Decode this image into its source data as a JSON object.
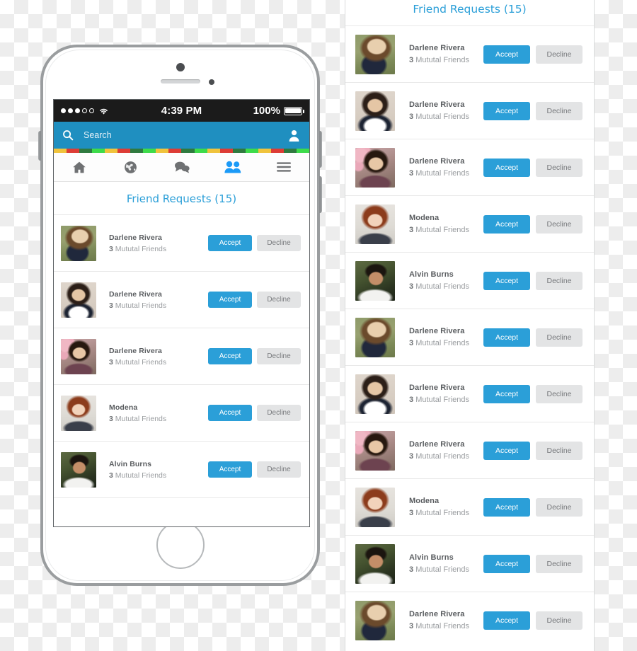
{
  "status_bar": {
    "signal_dots_filled": 3,
    "signal_dots_total": 5,
    "wifi_icon": "wifi-icon",
    "time": "4:39 PM",
    "battery_percent": "100%"
  },
  "search": {
    "icon": "search-icon",
    "placeholder": "Search",
    "profile_icon": "profile-avatar-icon"
  },
  "stripe_colors": [
    "#f0c33c",
    "#dd3c35",
    "#2f7a3f",
    "#3ddb4a"
  ],
  "tabs": [
    {
      "name": "home",
      "icon": "home-icon",
      "active": false
    },
    {
      "name": "globe",
      "icon": "globe-icon",
      "active": false
    },
    {
      "name": "messages",
      "icon": "chat-bubbles-icon",
      "active": false
    },
    {
      "name": "friends",
      "icon": "friends-icon",
      "active": true
    },
    {
      "name": "menu",
      "icon": "hamburger-menu-icon",
      "active": false
    }
  ],
  "theme": {
    "accent_blue": "#2b9fd8",
    "searchbar_blue": "#1f8fc0",
    "decline_gray": "#e3e4e5",
    "title_blue": "#2b9fd8",
    "phone_frame_gray": "#9a9d9f"
  },
  "phone_screen": {
    "title": "Friend Requests (15)",
    "buttons": {
      "accept": "Accept",
      "decline": "Decline"
    },
    "requests": [
      {
        "name": "Darlene Rivera",
        "mutual_count": "3",
        "mutual_label": "Mututal Friends",
        "photo": "ph-blonde"
      },
      {
        "name": "Darlene Rivera",
        "mutual_count": "3",
        "mutual_label": "Mututal Friends",
        "photo": "ph-dark"
      },
      {
        "name": "Darlene Rivera",
        "mutual_count": "3",
        "mutual_label": "Mututal Friends",
        "photo": "ph-pink"
      },
      {
        "name": "Modena",
        "mutual_count": "3",
        "mutual_label": "Mututal Friends",
        "photo": "ph-red"
      },
      {
        "name": "Alvin Burns",
        "mutual_count": "3",
        "mutual_label": "Mututal Friends",
        "photo": "ph-man"
      }
    ]
  },
  "panel": {
    "title": "Friend Requests (15)",
    "buttons": {
      "accept": "Accept",
      "decline": "Decline"
    },
    "requests": [
      {
        "name": "Darlene Rivera",
        "mutual_count": "3",
        "mutual_label": "Mututal Friends",
        "photo": "ph-blonde"
      },
      {
        "name": "Darlene Rivera",
        "mutual_count": "3",
        "mutual_label": "Mututal Friends",
        "photo": "ph-dark"
      },
      {
        "name": "Darlene Rivera",
        "mutual_count": "3",
        "mutual_label": "Mututal Friends",
        "photo": "ph-pink"
      },
      {
        "name": "Modena",
        "mutual_count": "3",
        "mutual_label": "Mututal Friends",
        "photo": "ph-red"
      },
      {
        "name": "Alvin Burns",
        "mutual_count": "3",
        "mutual_label": "Mututal Friends",
        "photo": "ph-man"
      },
      {
        "name": "Darlene Rivera",
        "mutual_count": "3",
        "mutual_label": "Mututal Friends",
        "photo": "ph-blonde"
      },
      {
        "name": "Darlene Rivera",
        "mutual_count": "3",
        "mutual_label": "Mututal Friends",
        "photo": "ph-dark"
      },
      {
        "name": "Darlene Rivera",
        "mutual_count": "3",
        "mutual_label": "Mututal Friends",
        "photo": "ph-pink"
      },
      {
        "name": "Modena",
        "mutual_count": "3",
        "mutual_label": "Mututal Friends",
        "photo": "ph-red"
      },
      {
        "name": "Alvin Burns",
        "mutual_count": "3",
        "mutual_label": "Mututal Friends",
        "photo": "ph-man"
      },
      {
        "name": "Darlene Rivera",
        "mutual_count": "3",
        "mutual_label": "Mututal Friends",
        "photo": "ph-blonde"
      }
    ]
  }
}
